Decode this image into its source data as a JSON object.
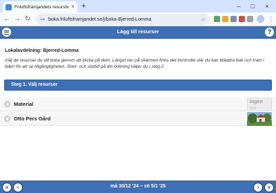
{
  "browser": {
    "tab_title": "Friluftsfrämjandets resursboknin",
    "tab_close": "×",
    "new_tab": "+",
    "minimize": "–",
    "maximize": "□",
    "close_window": "×",
    "back": "←",
    "forward": "→",
    "reload": "↻",
    "url": "boka.friluftsframjandet.se/j/boka-Bjerred-Lomma",
    "site_info": "⊶",
    "bookmark": "☆",
    "menu": "⋮"
  },
  "header": {
    "title": "Lägg till resurser",
    "help": "?"
  },
  "main": {
    "lokalavdelning": "Lokalavdelning: Bjerred-Lomma",
    "intro": "Välj de resurser du vill boka genom att klicka på dem. Längst ner på skärmen finns det kontroller där du kan bläddra bak och fram i tiden för att se tillgängligheten. Start- och sluttid på din bokning väljer du i steg 2.",
    "step_title": "Steg 1. Välj resurser",
    "resources": [
      {
        "name": "Material",
        "thumb_text": "Ingen",
        "thumb_subtext": "bild"
      },
      {
        "name": "Otto Pers Gård"
      }
    ]
  },
  "footer": {
    "range": "må 30/12 '24 – sö 5/1 '25",
    "first": "«",
    "prev": "‹",
    "next": "›",
    "last": "»"
  },
  "colors": {
    "accent": "#3f6fb5",
    "browser_tab_bg": "#d3e3fd"
  }
}
